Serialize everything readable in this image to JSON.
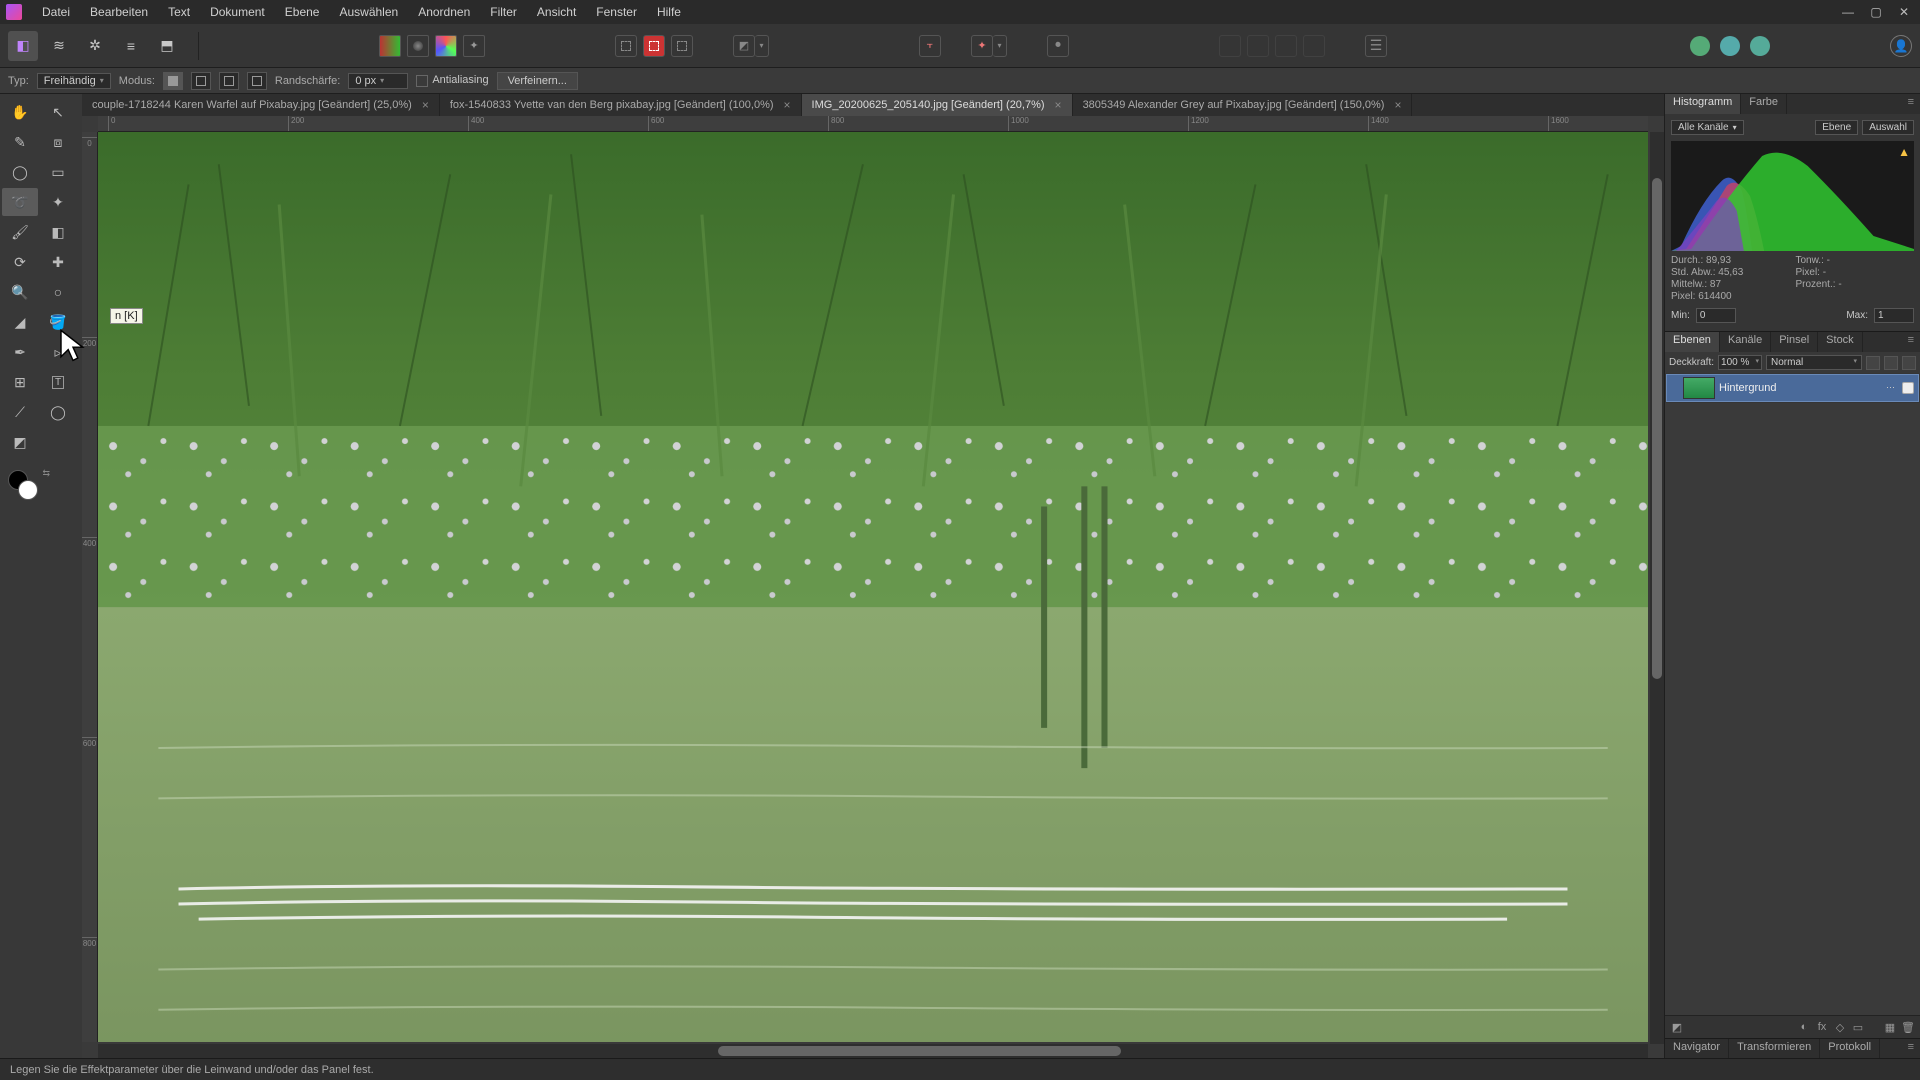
{
  "menu": [
    "Datei",
    "Bearbeiten",
    "Text",
    "Dokument",
    "Ebene",
    "Auswählen",
    "Anordnen",
    "Filter",
    "Ansicht",
    "Fenster",
    "Hilfe"
  ],
  "window_controls": {
    "min": "—",
    "max": "▢",
    "close": "✕"
  },
  "context_bar": {
    "type_label": "Typ:",
    "type_value": "Freihändig",
    "mode_label": "Modus:",
    "feather_label": "Randschärfe:",
    "feather_value": "0 px",
    "antialias_label": "Antialiasing",
    "refine_label": "Verfeinern..."
  },
  "tooltip": "n [K]",
  "tabs": [
    {
      "title": "couple-1718244 Karen Warfel auf Pixabay.jpg [Geändert] (25,0%)",
      "active": false
    },
    {
      "title": "fox-1540833 Yvette van den Berg pixabay.jpg [Geändert] (100,0%)",
      "active": false
    },
    {
      "title": "IMG_20200625_205140.jpg [Geändert] (20,7%)",
      "active": true
    },
    {
      "title": "3805349 Alexander Grey auf Pixabay.jpg [Geändert] (150,0%)",
      "active": false
    }
  ],
  "right_panel": {
    "top_tabs": [
      "Histogramm",
      "Farbe"
    ],
    "channel_label": "Alle Kanäle",
    "btn_ebene": "Ebene",
    "btn_auswahl": "Auswahl",
    "stats": {
      "durch_label": "Durch.:",
      "durch_val": "89,93",
      "median_label": "Tonw.:",
      "median_val": "-",
      "std_label": "Std. Abw.:",
      "std_val": "45,63",
      "pixel2_label": "Pixel:",
      "pixel2_val": "-",
      "mittel_label": "Mittelw.:",
      "mittel_val": "87",
      "perc_label": "Prozent.:",
      "perc_val": "-",
      "pixel_label": "Pixel:",
      "pixel_val": "614400"
    },
    "min_label": "Min:",
    "min_val": "0",
    "max_label": "Max:",
    "max_val": "1",
    "mid_tabs": [
      "Ebenen",
      "Kanäle",
      "Pinsel",
      "Stock"
    ],
    "opacity_label": "Deckkraft:",
    "opacity_value": "100 %",
    "blend_value": "Normal",
    "layer_name": "Hintergrund",
    "bottom_tabs": [
      "Navigator",
      "Transformieren",
      "Protokoll"
    ]
  },
  "status_text": "Legen Sie die Effektparameter über die Leinwand und/oder das Panel fest.",
  "ruler_h": [
    "0",
    "200",
    "400",
    "600",
    "800",
    "1000",
    "1200",
    "1400",
    "1600"
  ],
  "ruler_v": [
    "0",
    "200",
    "400",
    "600",
    "800"
  ]
}
